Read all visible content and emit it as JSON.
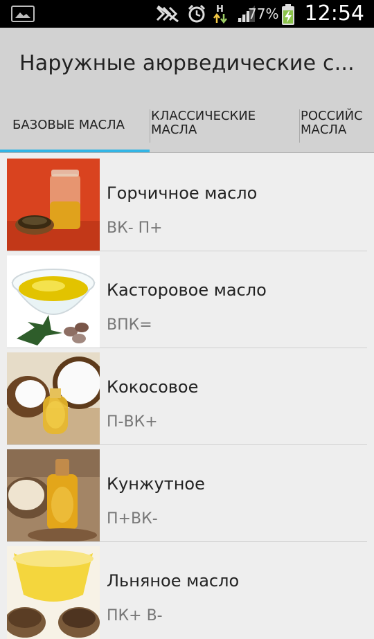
{
  "status_bar": {
    "battery_percent": "77%",
    "time": "12:54",
    "network_label": "H",
    "icons": [
      "gallery-icon",
      "mute-icon",
      "alarm-icon",
      "data-arrows-icon",
      "signal-icon",
      "battery-charging-icon"
    ]
  },
  "action_bar": {
    "title": "Наружные аюрведические с..."
  },
  "tabs": [
    {
      "label": "БАЗОВЫЕ МАСЛА",
      "selected": true
    },
    {
      "label": "КЛАССИЧЕСКИЕ\nМАСЛА",
      "selected": false
    },
    {
      "label": "РОССИЙС\nМАСЛА",
      "selected": false
    }
  ],
  "accent_color": "#33b5e5",
  "items": [
    {
      "name": "Горчичное масло",
      "dosha": "ВК- П+",
      "image": "mustard-oil-image"
    },
    {
      "name": "Касторовое масло",
      "dosha": "ВПК=",
      "image": "castor-oil-image"
    },
    {
      "name": "Кокосовое",
      "dosha": "П-ВК+",
      "image": "coconut-oil-image"
    },
    {
      "name": "Кунжутное",
      "dosha": "П+ВК-",
      "image": "sesame-oil-image"
    },
    {
      "name": "Льняное масло",
      "dosha": "ПК+ В-",
      "image": "flaxseed-oil-image"
    }
  ]
}
